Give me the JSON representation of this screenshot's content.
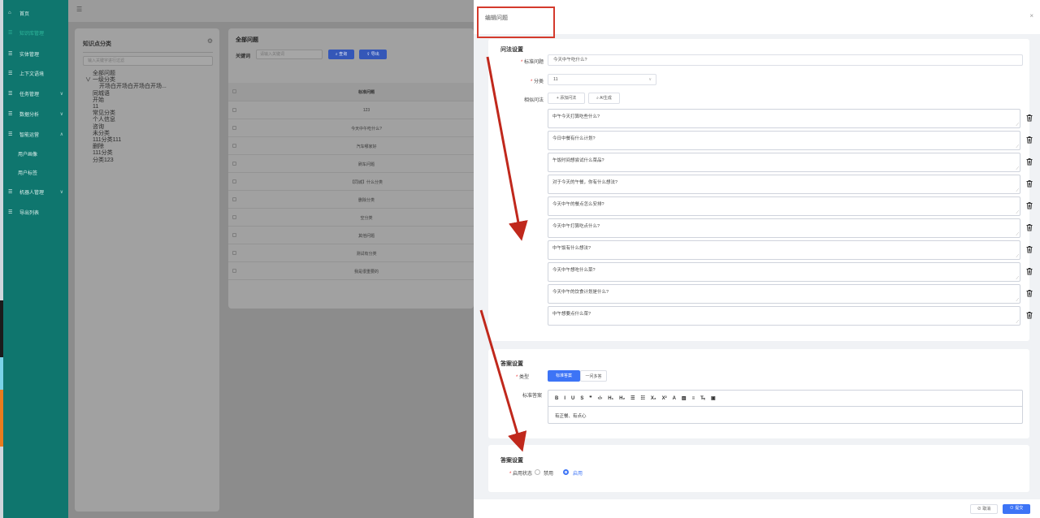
{
  "sidebar": {
    "items": [
      {
        "icon": "home-icon",
        "label": "首页"
      },
      {
        "icon": "doc-icon",
        "label": "知识库管理"
      },
      {
        "icon": "doc-icon",
        "label": "实体管理"
      },
      {
        "icon": "doc-icon",
        "label": "上下文语境"
      },
      {
        "icon": "doc-icon",
        "label": "任务管理"
      },
      {
        "icon": "doc-icon",
        "label": "数据分析"
      },
      {
        "icon": "doc-icon",
        "label": "智能运营"
      },
      {
        "icon": "none",
        "label": "用户画像"
      },
      {
        "icon": "none",
        "label": "用户标签"
      },
      {
        "icon": "doc-icon",
        "label": "机器人管理"
      },
      {
        "icon": "doc-icon",
        "label": "导出列表"
      }
    ]
  },
  "left_panel": {
    "title": "知识点分类",
    "search_placeholder": "输入关键字进行过滤",
    "tree": [
      "全部问题",
      "∨ 一级分类",
      "开场白开场白开场白开场...",
      "同城语",
      "开始",
      "11",
      "常见分类",
      "个人信息",
      "咨询",
      "未分类",
      "111分类111",
      "删除",
      "111分类",
      "分类123"
    ]
  },
  "right_panel": {
    "title": "全部问题",
    "keyword_label": "关键词",
    "keyword_placeholder": "请输入关键词",
    "query_button": "查询",
    "export_button": "导出",
    "column_header": "标准问题",
    "rows": [
      "123",
      "今天中午吃什么?",
      "汽车哪家好",
      "刷车问题",
      "【同城】什么分类",
      "删除分类",
      "空分类",
      "其他问题",
      "测试有分类",
      "我是很重要的"
    ]
  },
  "drawer": {
    "title": "编辑问题",
    "close": "×",
    "question_section": {
      "title": "问法设置",
      "standard_label": "标准问题",
      "standard_value": "今天中午吃什么?",
      "category_label": "分类",
      "category_value": "11",
      "similar_label": "相似问法",
      "add_button": "添加问法",
      "ai_button": "AI生成",
      "similar_items": [
        "中午今天打算吃些什么?",
        "今日中餐有什么计划?",
        "午饭时间想尝试什么菜品?",
        "对于今天的午餐，你有什么想法?",
        "今天中午的餐点怎么安排?",
        "今天中午打算吃点什么?",
        "中午饭有什么想法?",
        "今天中午想吃什么菜?",
        "今天中午的饮食计划是什么?",
        "中午想要点什么菜?"
      ]
    },
    "answer_section": {
      "title": "答案设置",
      "type_label": "类型",
      "type_selected": "标准答案",
      "type_other": "一问多答",
      "answer_label": "标准答案",
      "toolbar": [
        "B",
        "I",
        "U",
        "S",
        "❞",
        "‹/›",
        "H₁",
        "H₂",
        "☰",
        "☷",
        "X₂",
        "X²",
        "A",
        "▨",
        "≡",
        "T̶ₓ",
        "▣"
      ],
      "answer_text": "有正餐、有点心"
    },
    "status_section": {
      "title": "答案设置",
      "status_label": "启用状态",
      "option_disabled": "禁用",
      "option_enabled": "启用",
      "selected": "启用"
    },
    "footer": {
      "cancel": "取消",
      "submit": "提交"
    }
  },
  "colors": {
    "sidebar": "#0f766e",
    "primary": "#3d74f6",
    "annotation": "#d43a2c"
  }
}
